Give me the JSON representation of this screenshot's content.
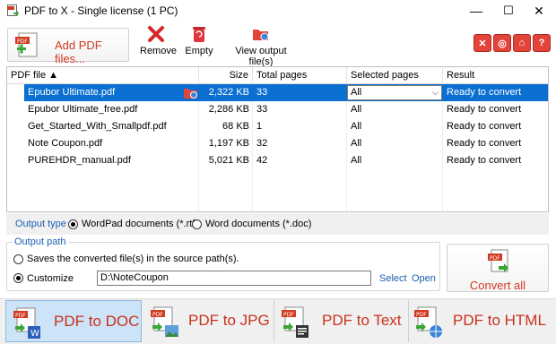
{
  "window": {
    "title": "PDF to X - Single license (1 PC)",
    "min_icon": "—",
    "max_icon": "☐",
    "close_icon": "✕"
  },
  "toolbar": {
    "add_label": "Add PDF files...",
    "remove_label": "Remove",
    "empty_label": "Empty",
    "view_label": "View output file(s)",
    "icons": [
      "close-circle-icon",
      "globe-icon",
      "home-icon",
      "help-icon"
    ]
  },
  "grid": {
    "columns": [
      "PDF file ▲",
      "Size",
      "Total pages",
      "Selected pages",
      "Result"
    ],
    "rows": [
      {
        "file": "Epubor Ultimate.pdf",
        "size": "2,322 KB",
        "pages": "33",
        "selected": "All",
        "result": "Ready to convert"
      },
      {
        "file": "Epubor Ultimate_free.pdf",
        "size": "2,286 KB",
        "pages": "33",
        "selected": "All",
        "result": "Ready to convert"
      },
      {
        "file": "Get_Started_With_Smallpdf.pdf",
        "size": "68 KB",
        "pages": "1",
        "selected": "All",
        "result": "Ready to convert"
      },
      {
        "file": "Note Coupon.pdf",
        "size": "1,197 KB",
        "pages": "32",
        "selected": "All",
        "result": "Ready to convert"
      },
      {
        "file": "PUREHDR_manual.pdf",
        "size": "5,021 KB",
        "pages": "42",
        "selected": "All",
        "result": "Ready to convert"
      }
    ]
  },
  "output_type": {
    "label": "Output type",
    "option1": "WordPad documents (*.rtf)",
    "option2": "Word documents (*.doc)",
    "selected": "option1"
  },
  "output_path": {
    "label": "Output path",
    "source_option": "Saves the converted file(s) in the source path(s).",
    "custom_option": "Customize",
    "path_value": "D:\\NoteCoupon",
    "select_link": "Select",
    "open_link": "Open"
  },
  "convert": {
    "label": "Convert all"
  },
  "tabs": [
    {
      "label": "PDF to DOC",
      "active": true
    },
    {
      "label": "PDF to JPG",
      "active": false
    },
    {
      "label": "PDF to Text",
      "active": false
    },
    {
      "label": "PDF to HTML",
      "active": false
    }
  ],
  "colors": {
    "accent_red": "#d23a1f",
    "selection_blue": "#0a6fd1",
    "link_blue": "#1a5fb4",
    "tab_active": "#cde3f7"
  }
}
